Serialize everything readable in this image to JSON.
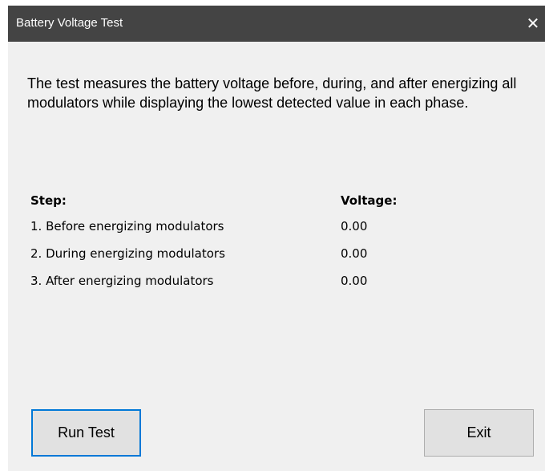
{
  "window": {
    "title": "Battery Voltage Test",
    "close_glyph": "✕"
  },
  "description": "The test measures the battery voltage before, during, and after energizing all modulators while displaying the lowest detected value in each phase.",
  "table": {
    "headers": {
      "step": "Step:",
      "voltage": "Voltage:"
    },
    "rows": [
      {
        "step": "1. Before energizing modulators",
        "voltage": "0.00"
      },
      {
        "step": "2. During energizing modulators",
        "voltage": "0.00"
      },
      {
        "step": "3. After energizing modulators",
        "voltage": "0.00"
      }
    ]
  },
  "buttons": {
    "run_test": "Run Test",
    "exit": "Exit"
  },
  "colors": {
    "titlebar": "#444444",
    "dialog_background": "#f0f0f0",
    "focus_border": "#0078d7"
  }
}
